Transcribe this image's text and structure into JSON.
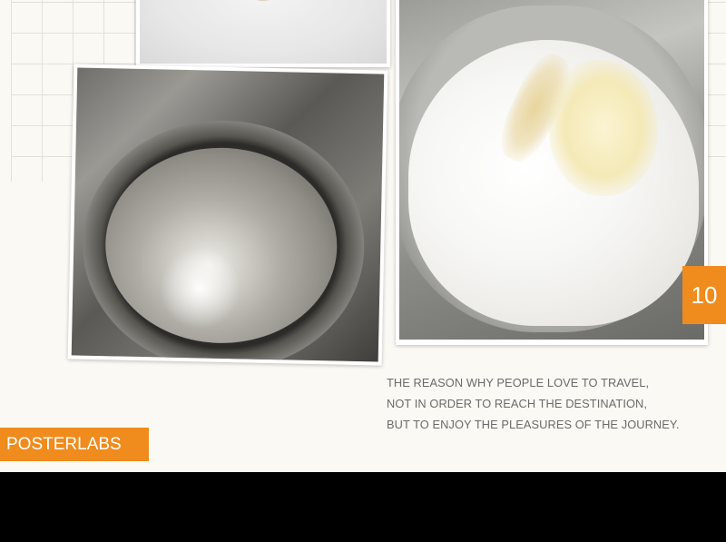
{
  "step_number": "10",
  "caption_lines": [
    "THE REASON WHY PEOPLE LOVE TO TRAVEL,",
    "NOT IN ORDER TO REACH THE DESTINATION,",
    "BUT TO ENJOY THE PLEASURES OF THE JOURNEY."
  ],
  "brand": "POSTERLABS",
  "colors": {
    "accent": "#f08b1e",
    "background": "#fbf9f4",
    "letterbox": "#000000"
  }
}
